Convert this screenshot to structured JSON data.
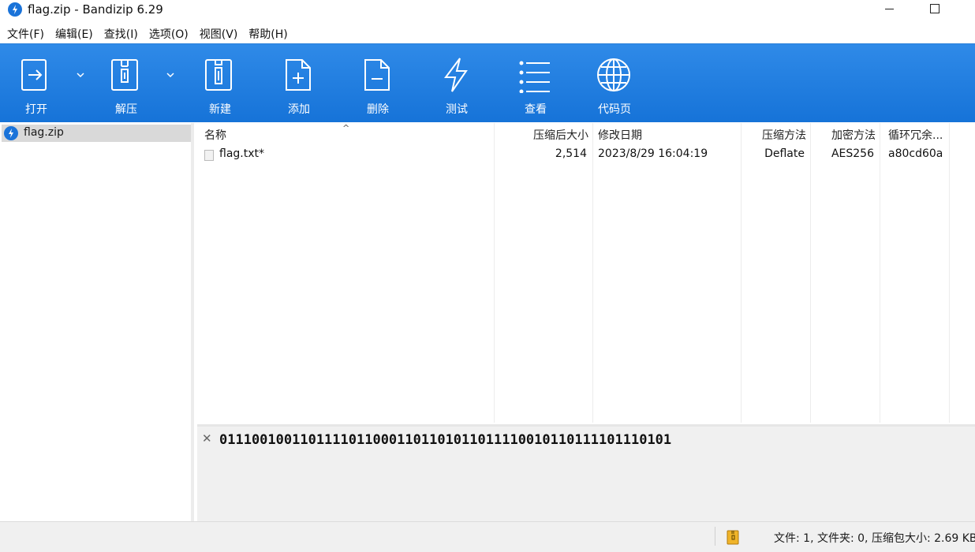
{
  "window": {
    "title": "flag.zip - Bandizip 6.29"
  },
  "menu": [
    "文件(F)",
    "编辑(E)",
    "查找(I)",
    "选项(O)",
    "视图(V)",
    "帮助(H)"
  ],
  "toolbar": {
    "open": "打开",
    "extract": "解压",
    "new": "新建",
    "add": "添加",
    "delete": "删除",
    "test": "测试",
    "view": "查看",
    "codepage": "代码页"
  },
  "tree": {
    "root": "flag.zip"
  },
  "columns": {
    "name": "名称",
    "packed_size": "压缩后大小",
    "modified": "修改日期",
    "method": "压缩方法",
    "encryption": "加密方法",
    "crc": "循环冗余..."
  },
  "files": [
    {
      "name": "flag.txt*",
      "packed_size": "2,514",
      "modified": "2023/8/29 16:04:19",
      "method": "Deflate",
      "encryption": "AES256",
      "crc": "a80cd60a"
    }
  ],
  "comment": {
    "text": "01110010011011110110001101101011011110010110111101110101"
  },
  "status": {
    "text": "文件: 1, 文件夹: 0, 压缩包大小: 2.69 KB"
  },
  "colors": {
    "toolbar_top": "#2f8ae8",
    "toolbar_bottom": "#1673d8",
    "app_icon": "#1a73d9",
    "selection": "#d9d9d9"
  }
}
